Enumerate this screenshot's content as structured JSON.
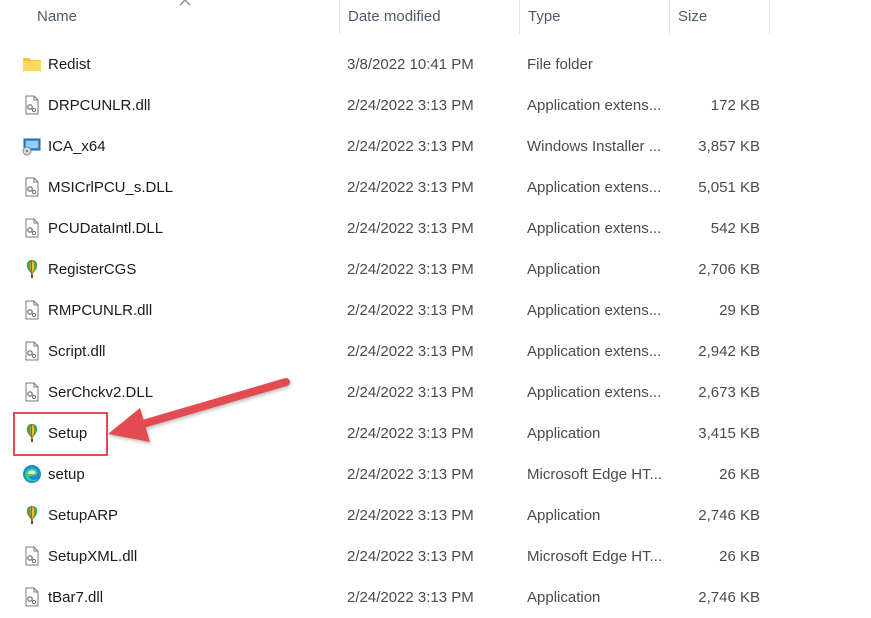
{
  "columns": {
    "name": "Name",
    "date": "Date modified",
    "type": "Type",
    "size": "Size"
  },
  "files": [
    {
      "name": "Redist",
      "date": "3/8/2022 10:41 PM",
      "type": "File folder",
      "size": "",
      "icon": "folder-icon"
    },
    {
      "name": "DRPCUNLR.dll",
      "date": "2/24/2022 3:13 PM",
      "type": "Application extens...",
      "size": "172 KB",
      "icon": "dll-file-icon"
    },
    {
      "name": "ICA_x64",
      "date": "2/24/2022 3:13 PM",
      "type": "Windows Installer ...",
      "size": "3,857 KB",
      "icon": "installer-icon"
    },
    {
      "name": "MSICrlPCU_s.DLL",
      "date": "2/24/2022 3:13 PM",
      "type": "Application extens...",
      "size": "5,051 KB",
      "icon": "dll-file-icon"
    },
    {
      "name": "PCUDataIntl.DLL",
      "date": "2/24/2022 3:13 PM",
      "type": "Application extens...",
      "size": "542 KB",
      "icon": "dll-file-icon"
    },
    {
      "name": "RegisterCGS",
      "date": "2/24/2022 3:13 PM",
      "type": "Application",
      "size": "2,706 KB",
      "icon": "balloon-app-icon"
    },
    {
      "name": "RMPCUNLR.dll",
      "date": "2/24/2022 3:13 PM",
      "type": "Application extens...",
      "size": "29 KB",
      "icon": "dll-file-icon"
    },
    {
      "name": "Script.dll",
      "date": "2/24/2022 3:13 PM",
      "type": "Application extens...",
      "size": "2,942 KB",
      "icon": "dll-file-icon"
    },
    {
      "name": "SerChckv2.DLL",
      "date": "2/24/2022 3:13 PM",
      "type": "Application extens...",
      "size": "2,673 KB",
      "icon": "dll-file-icon"
    },
    {
      "name": "Setup",
      "date": "2/24/2022 3:13 PM",
      "type": "Application",
      "size": "3,415 KB",
      "icon": "balloon-app-icon"
    },
    {
      "name": "setup",
      "date": "2/24/2022 3:13 PM",
      "type": "Microsoft Edge HT...",
      "size": "26 KB",
      "icon": "edge-icon"
    },
    {
      "name": "SetupARP",
      "date": "2/24/2022 3:13 PM",
      "type": "Application",
      "size": "2,746 KB",
      "icon": "balloon-app-icon"
    },
    {
      "name": "SetupXML.dll",
      "date": "2/24/2022 3:13 PM",
      "type": "Microsoft Edge HT...",
      "size": "26 KB",
      "icon": "dll-file-icon"
    },
    {
      "name": "tBar7.dll",
      "date": "2/24/2022 3:13 PM",
      "type": "Application",
      "size": "2,746 KB",
      "icon": "dll-file-icon"
    }
  ],
  "annotation": {
    "color": "#e34b52",
    "highlighted_file": "Setup"
  }
}
